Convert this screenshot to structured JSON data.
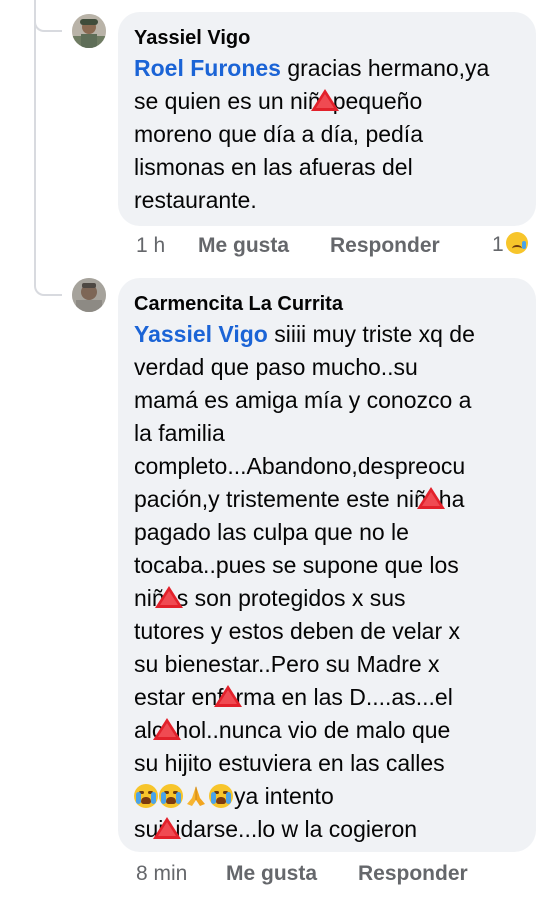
{
  "comments": [
    {
      "author": "Yassiel Vigo",
      "avatar_icon": "profile-photo-icon",
      "mention": "Roel Furones",
      "lines": [
        " gracias hermano,ya",
        "se quien es un niñ",
        "pequeño",
        "moreno que día a día, pedía",
        "lismonas en las afueras del",
        "restaurante."
      ],
      "time": "1 h",
      "like_label": "Me gusta",
      "reply_label": "Responder",
      "reaction_count": "1",
      "reaction_icon": "sad-face-icon"
    },
    {
      "author": "Carmencita La Currita",
      "avatar_icon": "profile-photo-icon",
      "mention": "Yassiel Vigo",
      "lines": [
        " siiii muy triste xq de",
        "verdad que paso mucho..su",
        "mamá es amiga mía y conozco a",
        "la familia",
        "completo...Abandono,despreocu",
        "pación,y tristemente este niñ",
        "ha",
        "pagado las culpa que no le",
        "tocaba..pues se supone que los",
        "niñ",
        "s son protegidos x sus",
        "tutores y estos deben de velar x",
        "su bienestar..Pero su Madre x",
        "estar enf",
        "rma en las D....as...el",
        "alc",
        "hol..nunca vio de malo que",
        "su hijito estuviera en las calles",
        "ya intento",
        "sui",
        "idarse...lo w la cogieron"
      ],
      "time": "8 min",
      "like_label": "Me gusta",
      "reply_label": "Responder"
    }
  ],
  "colors": {
    "bubble": "#f0f2f5",
    "mention": "#1b64d6",
    "meta": "#65676b",
    "warning": "#e2212b"
  },
  "inline_icons": [
    "warning-triangle-icon",
    "crying-face-icon",
    "folded-hands-icon"
  ]
}
